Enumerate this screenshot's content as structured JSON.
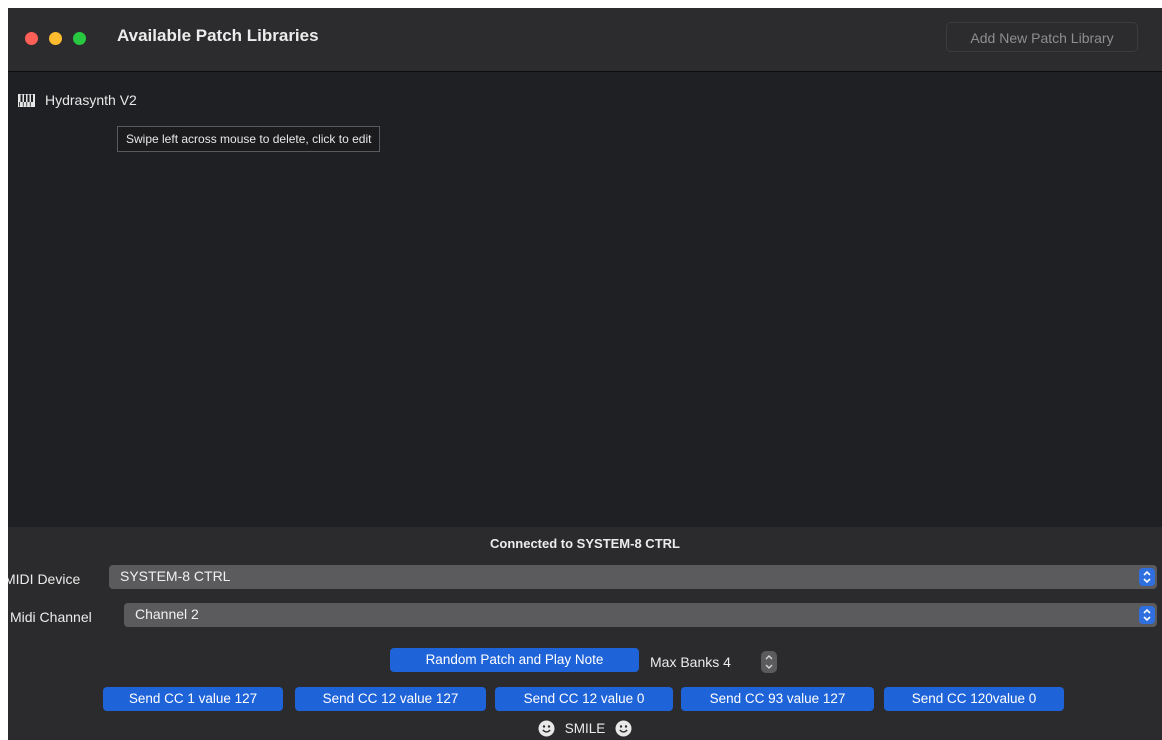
{
  "window": {
    "title": "Available Patch Libraries",
    "add_button_label": "Add New Patch Library"
  },
  "libraries": [
    {
      "name": "Hydrasynth V2",
      "icon": "piano-keys-icon"
    }
  ],
  "tooltip": "Swipe left across mouse to delete, click to edit",
  "status": "Connected to SYSTEM-8 CTRL",
  "midi_device": {
    "label": "MIDI Device",
    "value": "SYSTEM-8 CTRL"
  },
  "midi_channel": {
    "label": "Midi Channel",
    "value": "Channel 2"
  },
  "random_patch_button": "Random Patch and Play Note",
  "max_banks": {
    "label": "Max Banks 4"
  },
  "cc_buttons": [
    "Send CC 1 value 127",
    "Send CC 12 value 127",
    "Send CC 12 value 0",
    "Send CC 93 value 127",
    "Send CC 120value 0"
  ],
  "smile_label": "SMILE",
  "colors": {
    "accent_blue": "#1f63d9",
    "window_bg": "#1f2023",
    "panel_bg": "#2b2b2d",
    "close": "#ff5f57",
    "minimize": "#febc2e",
    "maximize": "#28c840"
  }
}
